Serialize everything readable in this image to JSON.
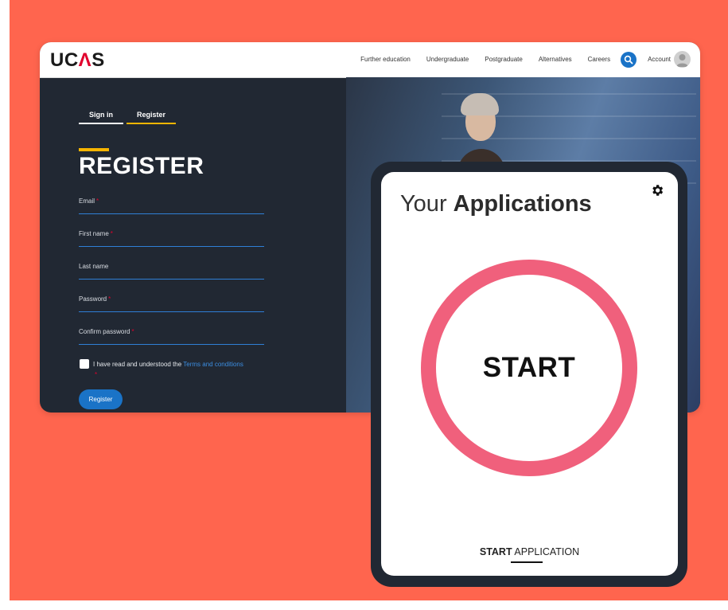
{
  "browser": {
    "logo": {
      "prefix": "UC",
      "caret": "Λ",
      "suffix": "S"
    },
    "nav": {
      "items": [
        "Further education",
        "Undergraduate",
        "Postgraduate",
        "Alternatives",
        "Careers"
      ],
      "search_icon": "search-icon",
      "account_label": "Account",
      "avatar_icon": "user-avatar-icon"
    },
    "tabs": [
      {
        "label": "Sign in"
      },
      {
        "label": "Register"
      }
    ],
    "form": {
      "title": "REGISTER",
      "fields": [
        {
          "label": "Email",
          "required": "*"
        },
        {
          "label": "First name",
          "required": "*"
        },
        {
          "label": "Last name",
          "required": ""
        },
        {
          "label": "Password",
          "required": "*"
        },
        {
          "label": "Confirm password",
          "required": "*"
        }
      ],
      "terms_text": "I have read and understood the",
      "terms_link": "Terms and conditions",
      "terms_required": "*",
      "submit_label": "Register"
    }
  },
  "phone": {
    "title_light": "Your",
    "title_bold": "Applications",
    "settings_icon": "gear-icon",
    "center_label": "START",
    "bottom_tab_bold": "START",
    "bottom_tab_rest": "APPLICATION"
  },
  "colors": {
    "background": "#ff654e",
    "dark_panel": "#212833",
    "accent_yellow": "#f7b500",
    "link_blue": "#1a73c7",
    "ring_pink": "#f0607c",
    "required_red": "#e1002d"
  }
}
